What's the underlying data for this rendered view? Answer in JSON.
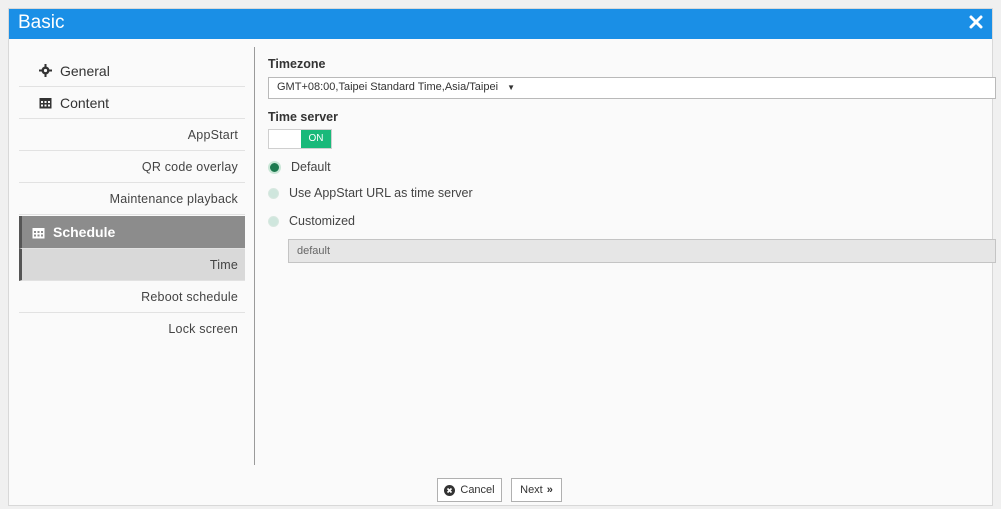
{
  "window": {
    "title": "Basic"
  },
  "sidebar": {
    "general": {
      "label": "General",
      "icon": "gear-icon"
    },
    "content": {
      "label": "Content",
      "icon": "calendar-icon",
      "items": [
        {
          "label": "AppStart"
        },
        {
          "label": "QR code overlay"
        },
        {
          "label": "Maintenance playback"
        }
      ]
    },
    "schedule": {
      "label": "Schedule",
      "icon": "calendar-icon",
      "items": [
        {
          "label": "Time"
        },
        {
          "label": "Reboot schedule"
        },
        {
          "label": "Lock screen"
        }
      ]
    }
  },
  "main": {
    "timezone_label": "Timezone",
    "timezone_value": "GMT+08:00,Taipei Standard Time,Asia/Taipei",
    "time_server_label": "Time server",
    "toggle_label": "ON",
    "options": [
      {
        "label": "Default",
        "selected": true
      },
      {
        "label": "Use AppStart URL as time server",
        "selected": false
      },
      {
        "label": "Customized",
        "selected": false
      }
    ],
    "custom_value": "default"
  },
  "footer": {
    "cancel_label": "Cancel",
    "next_label": "Next"
  },
  "colors": {
    "titlebar": "#1a8fe6",
    "toggle_on": "#19b97a",
    "radio_selected": "#1d7a4f",
    "sidebar_active": "#8c8c8c"
  }
}
